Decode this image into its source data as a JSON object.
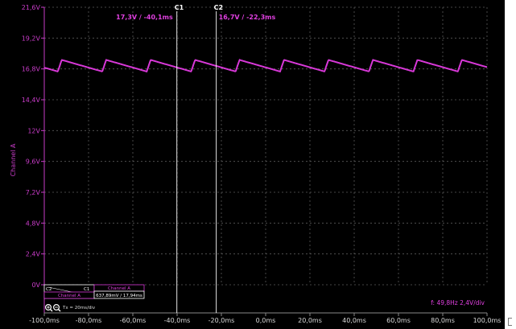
{
  "channel": {
    "name": "Channel A",
    "color": "#c83cc8"
  },
  "y_axis": {
    "labels": [
      "21,6V",
      "19,2V",
      "16,8V",
      "14,4V",
      "12V",
      "9,6V",
      "7,2V",
      "4,8V",
      "2,4V",
      "0V"
    ],
    "values": [
      21.6,
      19.2,
      16.8,
      14.4,
      12,
      9.6,
      7.2,
      4.8,
      2.4,
      0
    ],
    "range": [
      0,
      21.6
    ]
  },
  "x_axis": {
    "labels": [
      "-100,0ms",
      "-80,0ms",
      "-60,0ms",
      "-40,0ms",
      "-20,0ms",
      "0,0ms",
      "20,0ms",
      "40,0ms",
      "60,0ms",
      "80,0ms",
      "100,0ms"
    ],
    "values": [
      -100,
      -80,
      -60,
      -40,
      -20,
      0,
      20,
      40,
      60,
      80,
      100
    ],
    "range": [
      -100,
      100
    ]
  },
  "cursors": [
    {
      "tag": "C1",
      "time_ms": -40.1,
      "readout": "17,3V / -40,1ms"
    },
    {
      "tag": "C2",
      "time_ms": -22.3,
      "readout": "16,7V / -22,3ms"
    }
  ],
  "measurement_box": {
    "left_tags": [
      "C2",
      "C1"
    ],
    "header": "Channel A",
    "channel_label": "Channel A",
    "value": "637,89mV / 17,94ms"
  },
  "zoom": {
    "label": "Tx = 20ms/div",
    "icons": [
      "zoom-in-icon",
      "zoom-out-icon"
    ]
  },
  "status": {
    "frequency_text": "f: 49,8Hz 2,4V/div"
  },
  "waveform": {
    "period_ms": 20.08,
    "high_v": 17.5,
    "low_v": 16.6,
    "drop_ms": 1.8,
    "first_peak_ms": -92.1
  }
}
